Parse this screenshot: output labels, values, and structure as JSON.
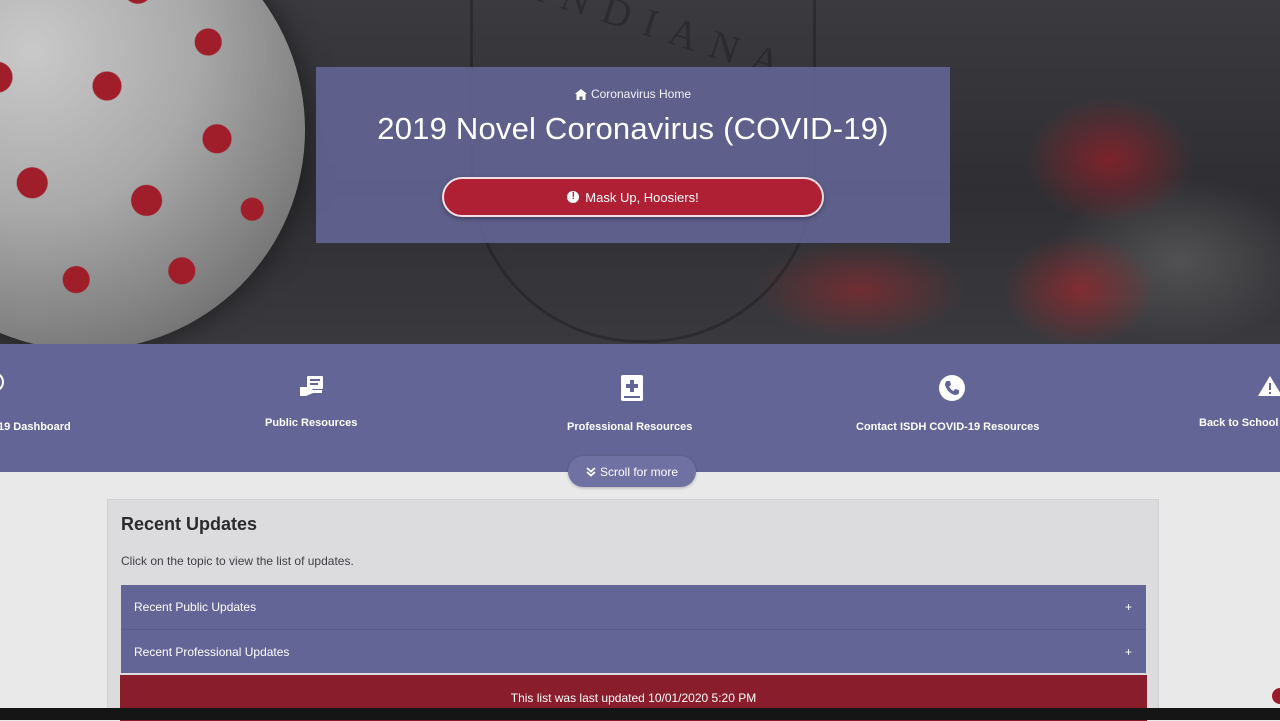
{
  "hero": {
    "breadcrumb_label": "Coronavirus Home",
    "title": "2019 Novel Coronavirus (COVID-19)",
    "cta_label": "Mask Up, Hoosiers!",
    "watermark": "INDIANA"
  },
  "nav": {
    "items": [
      {
        "label": "19 Dashboard",
        "icon": "info-icon"
      },
      {
        "label": "Public Resources",
        "icon": "public-resources-icon"
      },
      {
        "label": "Professional Resources",
        "icon": "medical-book-icon"
      },
      {
        "label": "Contact ISDH COVID-19 Resources",
        "icon": "phone-icon"
      },
      {
        "label": "Back to School",
        "icon": "warning-icon"
      }
    ],
    "scroll_label": "Scroll for more"
  },
  "updates": {
    "title": "Recent Updates",
    "hint": "Click on the topic to view the list of updates.",
    "sections": [
      {
        "label": "Recent Public Updates",
        "toggle": "+"
      },
      {
        "label": "Recent Professional Updates",
        "toggle": "+"
      }
    ],
    "last_updated": "This list was last updated 10/01/2020 5:20 PM"
  },
  "colors": {
    "band_purple": "#636596",
    "cta_red": "#b02035",
    "updated_red": "#8a1d2c"
  }
}
